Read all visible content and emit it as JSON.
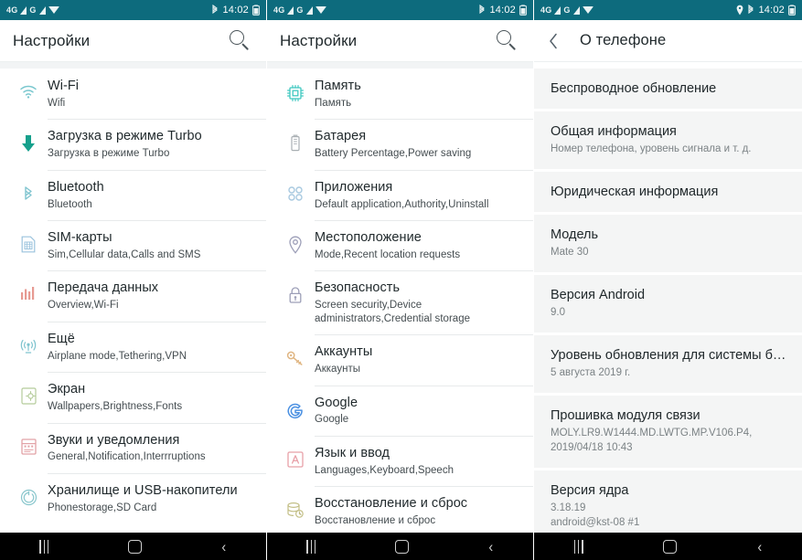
{
  "statusbar": {
    "network_4g": "4G",
    "network_g": "G",
    "time": "14:02",
    "icons": [
      "signal-triangle-icon",
      "signal-triangle-icon",
      "wifi-icon",
      "bluetooth-icon",
      "battery-icon"
    ],
    "icons_panel3": [
      "location-pin-icon",
      "bluetooth-icon",
      "battery-icon"
    ],
    "bluetooth_glyph": "✶",
    "location_glyph": "⌘"
  },
  "navbar": {
    "recents_label": "recents-button",
    "home_label": "home-button",
    "back_glyph": "‹"
  },
  "panel1": {
    "title": "Настройки",
    "search_icon": "search-icon",
    "items": [
      {
        "title": "Wi-Fi",
        "sub": "Wifi",
        "icon": "wifi-icon"
      },
      {
        "title": "Загрузка в режиме Turbo",
        "sub": "Загрузка в режиме Turbo",
        "icon": "download-arrow-icon"
      },
      {
        "title": "Bluetooth",
        "sub": "Bluetooth",
        "icon": "bluetooth-icon"
      },
      {
        "title": "SIM-карты",
        "sub": "Sim,Cellular data,Calls and SMS",
        "icon": "sim-card-icon"
      },
      {
        "title": "Передача данных",
        "sub": "Overview,Wi-Fi",
        "icon": "data-usage-icon"
      },
      {
        "title": "Ещё",
        "sub": "Airplane mode,Tethering,VPN",
        "icon": "broadcast-tower-icon"
      },
      {
        "title": "Экран",
        "sub": "Wallpapers,Brightness,Fonts",
        "icon": "display-icon"
      },
      {
        "title": "Звуки и уведомления",
        "sub": "General,Notification,Interrruptions",
        "icon": "sound-notification-icon"
      },
      {
        "title": "Хранилище и USB-накопители",
        "sub": "Phonestorage,SD Card",
        "icon": "storage-icon"
      }
    ]
  },
  "panel2": {
    "title": "Настройки",
    "search_icon": "search-icon",
    "items": [
      {
        "title": "Память",
        "sub": "Память",
        "icon": "memory-chip-icon"
      },
      {
        "title": "Батарея",
        "sub": "Battery Percentage,Power saving",
        "icon": "battery-icon"
      },
      {
        "title": "Приложения",
        "sub": "Default application,Authority,Uninstall",
        "icon": "apps-grid-icon"
      },
      {
        "title": "Местоположение",
        "sub": "Mode,Recent location requests",
        "icon": "location-pin-icon"
      },
      {
        "title": "Безопасность",
        "sub": "Screen security,Device administrators,Credential storage",
        "icon": "lock-icon"
      },
      {
        "title": "Аккаунты",
        "sub": "Аккаунты",
        "icon": "key-icon"
      },
      {
        "title": "Google",
        "sub": "Google",
        "icon": "google-g-icon"
      },
      {
        "title": "Язык и ввод",
        "sub": "Languages,Keyboard,Speech",
        "icon": "language-a-icon"
      },
      {
        "title": "Восстановление и сброс",
        "sub": "Восстановление и сброс",
        "icon": "backup-reset-icon"
      }
    ]
  },
  "panel3": {
    "title": "О телефоне",
    "back_icon": "back-chevron-icon",
    "items": [
      {
        "title": "Беспроводное обновление",
        "sub": ""
      },
      {
        "title": "Общая информация",
        "sub": "Номер телефона, уровень сигнала и т. д."
      },
      {
        "title": "Юридическая информация",
        "sub": ""
      },
      {
        "title": "Модель",
        "sub": "Mate 30"
      },
      {
        "title": "Версия Android",
        "sub": "9.0"
      },
      {
        "title": "Уровень обновления для системы б…",
        "sub": "5 августа 2019 г."
      },
      {
        "title": "Прошивка модуля связи",
        "sub": "MOLY.LR9.W1444.MD.LWTG.MP.V106.P4,\n2019/04/18 10:43"
      },
      {
        "title": "Версия ядра",
        "sub": "3.18.19\nandroid@kst-08 #1"
      }
    ]
  },
  "colors": {
    "statusbar_teal": "#0d6b7d",
    "navbar_black": "#000000",
    "title_text": "#20292c",
    "sub_text": "#444c50",
    "about_row_bg": "#f4f5f5"
  }
}
